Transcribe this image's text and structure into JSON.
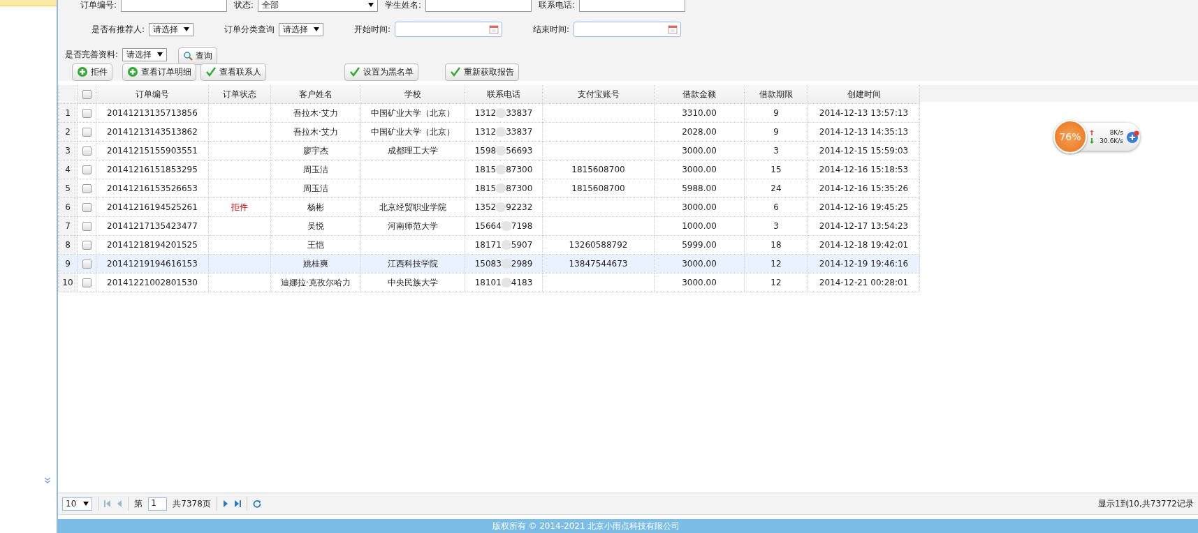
{
  "filters": {
    "row_1": [
      {
        "label": "订单编号:",
        "kind": "text"
      },
      {
        "label": "状态:",
        "kind": "select",
        "value": "全部"
      },
      {
        "label": "学生姓名:",
        "kind": "text"
      },
      {
        "label": "联系电话:",
        "kind": "text"
      }
    ],
    "row_2": [
      {
        "label": "是否有推荐人:",
        "kind": "select",
        "value": "请选择"
      },
      {
        "label": "订单分类查询",
        "kind": "select",
        "value": "请选择"
      },
      {
        "label": "开始时间:",
        "kind": "date"
      },
      {
        "label": "结束时间:",
        "kind": "date"
      }
    ],
    "row_3": [
      {
        "label": "是否完善资料:",
        "kind": "select",
        "value": "请选择"
      }
    ],
    "search_button": "查询"
  },
  "toolbar": [
    {
      "label": "拒件",
      "kind": "add"
    },
    {
      "label": "查看订单明细",
      "kind": "add"
    },
    {
      "label": "查看联系人",
      "kind": "confirm"
    },
    {
      "label": "设置为黑名单",
      "kind": "confirm"
    },
    {
      "label": "重新获取报告",
      "kind": "confirm"
    }
  ],
  "table": {
    "columns": [
      "订单编号",
      "订单状态",
      "客户姓名",
      "学校",
      "联系电话",
      "支付宝账号",
      "借款金额",
      "借款期限",
      "创建时间"
    ],
    "all_checked": false,
    "rows": [
      {
        "n": "1",
        "checked": false,
        "selected": false,
        "order": "20141213135713856",
        "name": "吾拉木·艾力",
        "school": "中国矿业大学（北京）",
        "phone_start": "1312",
        "phone_end": "33837",
        "amount": "3310.00",
        "term": "9",
        "created": "2014-12-13 13:57:13"
      },
      {
        "n": "2",
        "checked": false,
        "selected": false,
        "order": "20141213143513862",
        "name": "吾拉木·艾力",
        "school": "中国矿业大学（北京）",
        "phone_start": "1312",
        "phone_end": "33837",
        "amount": "2028.00",
        "term": "9",
        "created": "2014-12-13 14:35:13"
      },
      {
        "n": "3",
        "checked": false,
        "selected": false,
        "order": "20141215155903551",
        "name": "廖宇杰",
        "school": "成都理工大学",
        "phone_start": "1598",
        "phone_end": "56693",
        "amount": "3000.00",
        "term": "3",
        "created": "2014-12-15 15:59:03"
      },
      {
        "n": "4",
        "checked": false,
        "selected": false,
        "order": "20141216151853295",
        "name": "周玉洁",
        "phone_start": "1815",
        "phone_end": "87300",
        "alipay": "1815608700",
        "amount": "3000.00",
        "term": "15",
        "created": "2014-12-16 15:18:53"
      },
      {
        "n": "5",
        "checked": false,
        "selected": false,
        "order": "20141216153526653",
        "name": "周玉洁",
        "phone_start": "1815",
        "phone_end": "87300",
        "alipay": "1815608700",
        "amount": "5988.00",
        "term": "24",
        "created": "2014-12-16 15:35:26"
      },
      {
        "n": "6",
        "checked": false,
        "selected": false,
        "order": "20141216194525261",
        "status": "拒件",
        "name": "杨彬",
        "school": "北京经贸职业学院",
        "phone_start": "1352",
        "phone_end": "92232",
        "amount": "3000.00",
        "term": "6",
        "created": "2014-12-16 19:45:25"
      },
      {
        "n": "7",
        "checked": false,
        "selected": false,
        "order": "20141217135423477",
        "name": "吴悦",
        "school": "河南师范大学",
        "phone_start": "15664",
        "phone_end": "7198",
        "amount": "1000.00",
        "term": "3",
        "created": "2014-12-17 13:54:23"
      },
      {
        "n": "8",
        "checked": false,
        "selected": false,
        "order": "20141218194201525",
        "name": "王恺",
        "phone_start": "18171",
        "phone_end": "5907",
        "alipay": "13260588792",
        "amount": "5999.00",
        "term": "18",
        "created": "2014-12-18 19:42:01"
      },
      {
        "n": "9",
        "checked": false,
        "selected": true,
        "order": "20141219194616153",
        "name": "姚桂爽",
        "school": "江西科技学院",
        "phone_start": "15083",
        "phone_end": "2989",
        "alipay": "13847544673",
        "amount": "3000.00",
        "term": "12",
        "created": "2014-12-19 19:46:16"
      },
      {
        "n": "10",
        "checked": false,
        "selected": false,
        "order": "20141221002801530",
        "name": "迪娜拉·克孜尔哈力",
        "school": "中央民族大学",
        "phone_start": "18101",
        "phone_end": "4183",
        "amount": "3000.00",
        "term": "12",
        "created": "2014-12-21 00:28:01"
      }
    ]
  },
  "pager": {
    "page_size": "10",
    "page_label": "第",
    "page": "1",
    "total_pages": "共7378页",
    "summary": "显示1到10,共73772记录"
  },
  "speed_widget": {
    "percent": "76%",
    "up": "8K/s",
    "down": "30.6K/s"
  },
  "footer": "版权所有 © 2014-2021 北京小雨点科技有限公司"
}
